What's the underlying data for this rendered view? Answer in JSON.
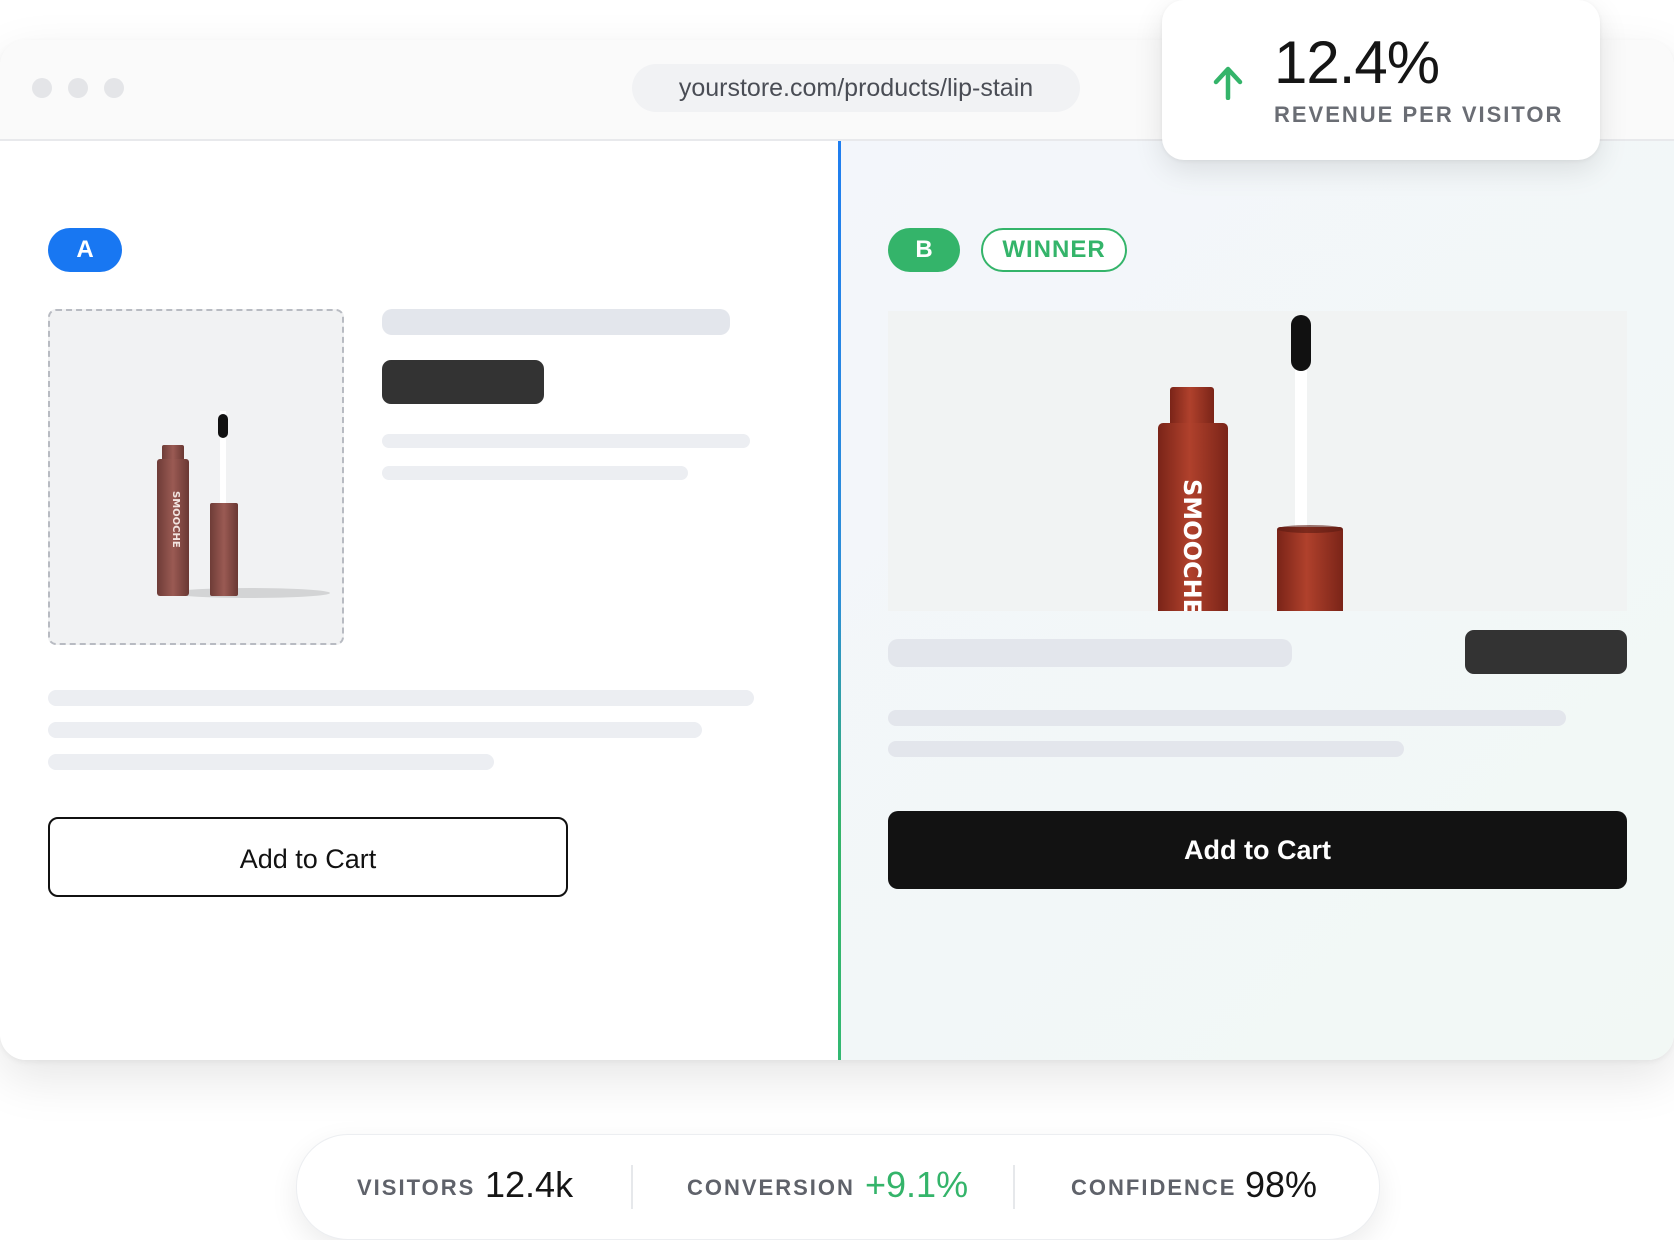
{
  "browser": {
    "url": "yourstore.com/products/lip-stain"
  },
  "metric_card": {
    "value": "12.4%",
    "label": "REVENUE PER VISITOR",
    "icon": "arrow-up-icon",
    "accent": "#34b46a"
  },
  "variant_a": {
    "badge": "A",
    "badge_color": "#1877f2",
    "cta_label": "Add to Cart",
    "product_brand": "SMOOCHE"
  },
  "variant_b": {
    "badge": "B",
    "badge_color": "#34b46a",
    "winner_label": "WINNER",
    "cta_label": "Add to Cart",
    "product_brand": "SMOOCHE"
  },
  "stats": [
    {
      "label": "VISITORS",
      "value": "12.4k"
    },
    {
      "label": "CONVERSION",
      "value": "+9.1%"
    },
    {
      "label": "CONFIDENCE",
      "value": "98%"
    }
  ]
}
